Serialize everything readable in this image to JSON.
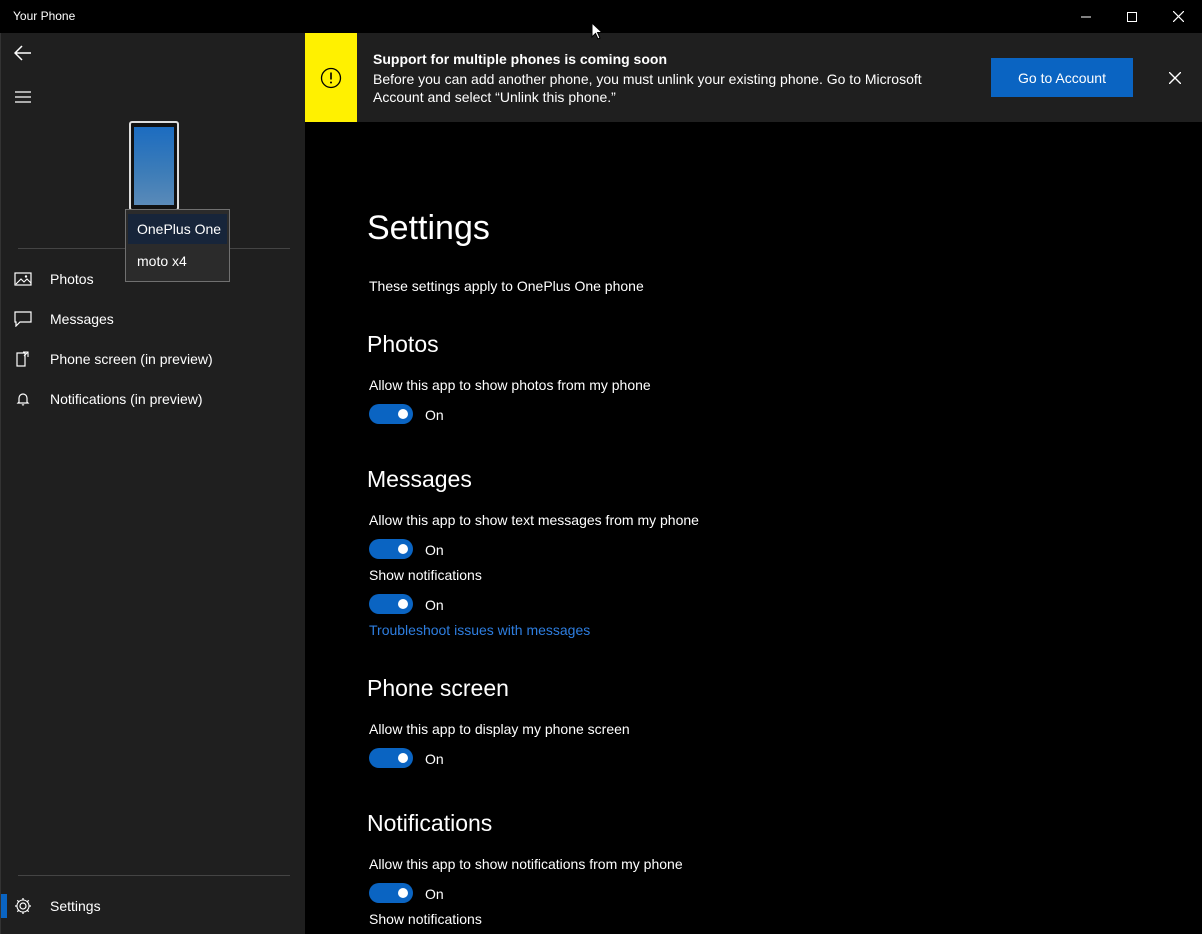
{
  "window": {
    "title": "Your Phone"
  },
  "sidebar": {
    "devices": [
      "OnePlus One",
      "moto x4"
    ],
    "selected_device": "OnePlus One",
    "items": [
      {
        "label": "Photos",
        "icon": "photos-icon"
      },
      {
        "label": "Messages",
        "icon": "message-icon"
      },
      {
        "label": "Phone screen (in preview)",
        "icon": "phone-screen-icon"
      },
      {
        "label": "Notifications (in preview)",
        "icon": "bell-icon"
      }
    ],
    "settings_label": "Settings"
  },
  "banner": {
    "title": "Support for multiple phones is coming soon",
    "body": "Before you can add another phone, you must unlink your existing phone. Go to Microsoft Account and select “Unlink this phone.”",
    "button_label": "Go to Account",
    "accent_color": "#fff100"
  },
  "settings": {
    "title": "Settings",
    "subtitle": "These settings apply to OnePlus One phone",
    "photos": {
      "heading": "Photos",
      "allow_label": "Allow this app to show photos from my phone",
      "allow_state": "On"
    },
    "messages": {
      "heading": "Messages",
      "allow_label": "Allow this app to show text messages from my phone",
      "allow_state": "On",
      "notifications_label": "Show notifications",
      "notifications_state": "On",
      "troubleshoot_link": "Troubleshoot issues with messages"
    },
    "phone_screen": {
      "heading": "Phone screen",
      "allow_label": "Allow this app to display my phone screen",
      "allow_state": "On"
    },
    "notifications": {
      "heading": "Notifications",
      "allow_label": "Allow this app to show notifications from my phone",
      "allow_state": "On",
      "notifications_label": "Show notifications"
    }
  },
  "colors": {
    "accent": "#0a64c2",
    "link": "#2e7ee0",
    "sidebar_bg": "#1f1f1f",
    "content_bg": "#000000"
  }
}
